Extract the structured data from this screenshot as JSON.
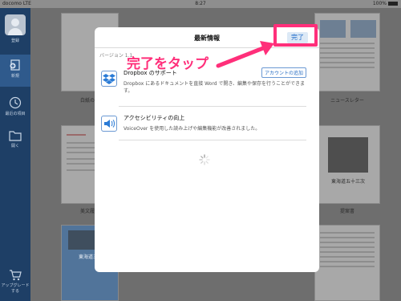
{
  "status_bar": {
    "carrier": "docomo",
    "network": "LTE",
    "time": "8:27",
    "battery": "100%"
  },
  "sidebar": {
    "items": [
      {
        "label": "登録"
      },
      {
        "label": "新規"
      },
      {
        "label": "最近の項目"
      },
      {
        "label": "開く"
      },
      {
        "label": "アップグレードする"
      }
    ]
  },
  "background_docs": {
    "captions": [
      "白紙の文",
      "ニュースレター",
      "美文履歴",
      "提案書"
    ],
    "thumb_titles": [
      "東海道五十",
      "東海道五十三次",
      "東海道五十"
    ]
  },
  "modal": {
    "title": "最新情報",
    "done_label": "完了",
    "version_label": "バージョン 1.1",
    "features": [
      {
        "title": "Dropbox のサポート",
        "description": "Dropbox にあるドキュメントを直接 Word で開き、編集や保存を行うことができます。",
        "button_label": "アカウントの追加",
        "icon": "dropbox-icon"
      },
      {
        "title": "アクセシビリティの向上",
        "description": "VoiceOver を使用した読み上げや編集機能が改善されました。",
        "icon": "speaker-icon"
      }
    ]
  },
  "annotation": {
    "callout_text": "完了をタップ",
    "color": "#ff2f7a"
  },
  "colors": {
    "sidebar": "#1e3f66",
    "accent": "#1a68c9",
    "annotation": "#ff2f7a"
  }
}
